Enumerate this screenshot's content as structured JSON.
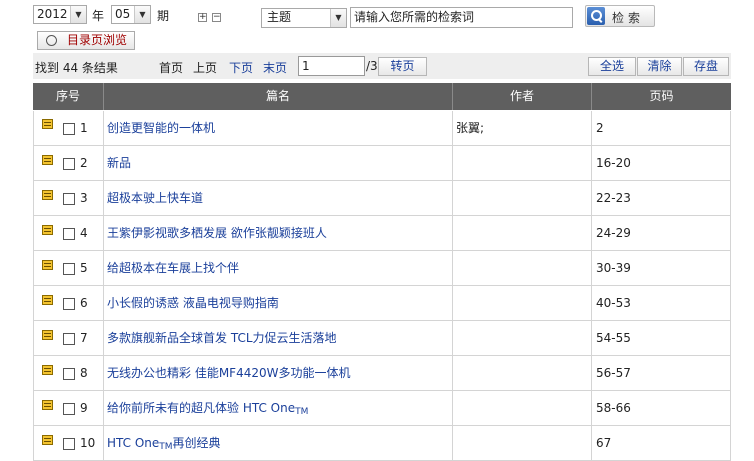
{
  "search": {
    "year_value": "2012",
    "year_unit": "年",
    "period_value": "05",
    "period_unit": "期",
    "field_value": "主题",
    "input_placeholder": "请输入您所需的检索词",
    "search_button": "检索",
    "catalog_button": "目录页浏览"
  },
  "toolbar": {
    "result_count": "找到 44 条结果",
    "first": "首页",
    "prev": "上页",
    "next": "下页",
    "last": "末页",
    "page_value": "1",
    "page_total": "/3",
    "go": "转页",
    "select_all": "全选",
    "clear": "清除",
    "save": "存盘"
  },
  "table": {
    "headers": [
      "序号",
      "篇名",
      "作者",
      "页码"
    ],
    "rows": [
      {
        "num": "1",
        "title": "创造更智能的一体机",
        "author": "张翼;",
        "pages": "2"
      },
      {
        "num": "2",
        "title": "新品",
        "author": "",
        "pages": "16-20"
      },
      {
        "num": "3",
        "title": "超极本驶上快车道",
        "author": "",
        "pages": "22-23"
      },
      {
        "num": "4",
        "title": "王紫伊影视歌多栖发展 欲作张靓颖接班人",
        "author": "",
        "pages": "24-29"
      },
      {
        "num": "5",
        "title": "给超极本在车展上找个伴",
        "author": "",
        "pages": "30-39"
      },
      {
        "num": "6",
        "title": "小长假的诱惑 液晶电视导购指南",
        "author": "",
        "pages": "40-53"
      },
      {
        "num": "7",
        "title": "多款旗舰新品全球首发 TCL力促云生活落地",
        "author": "",
        "pages": "54-55"
      },
      {
        "num": "8",
        "title": "无线办公也精彩 佳能MF4420W多功能一体机",
        "author": "",
        "pages": "56-57"
      },
      {
        "num": "9",
        "title": "给你前所未有的超凡体验 HTC One",
        "title_sub": "TM",
        "title_tail": "",
        "author": "",
        "pages": "58-66"
      },
      {
        "num": "10",
        "title": "HTC One",
        "title_sub": "TM",
        "title_tail": "再创经典",
        "author": "",
        "pages": "67"
      }
    ]
  }
}
